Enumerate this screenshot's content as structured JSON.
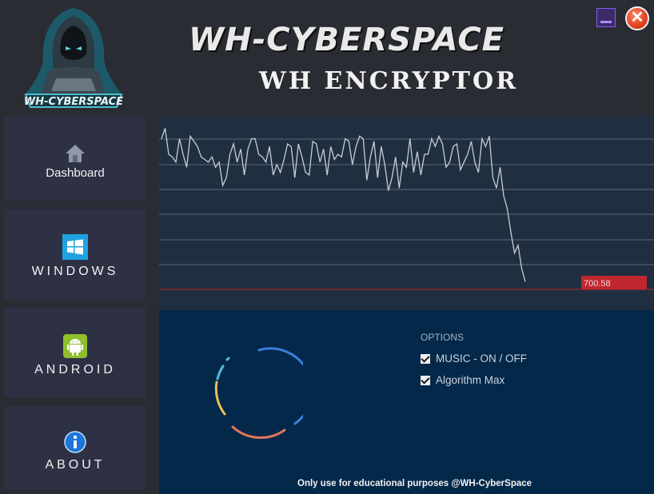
{
  "header": {
    "brand_title": "WH-CYBERSPACE",
    "app_title": "WH ENCRYPTOR",
    "logo_text": "WH-CYBERSPACE"
  },
  "window_controls": {
    "minimize_icon": "minimize-icon",
    "close_icon": "close-icon"
  },
  "sidebar": {
    "items": [
      {
        "label": "Dashboard",
        "icon": "home-icon"
      },
      {
        "label": "WINDOWS",
        "icon": "windows-logo-icon"
      },
      {
        "label": "ANDROID",
        "icon": "android-icon"
      },
      {
        "label": "ABOUT",
        "icon": "info-icon"
      }
    ]
  },
  "graph": {
    "current_value_label": "700.58",
    "line_color": "#c8ccd2",
    "threshold_color": "#c0262e",
    "values": [
      58,
      62,
      52,
      51,
      49,
      58,
      52,
      47,
      59,
      57,
      55,
      51,
      50,
      49,
      51,
      47,
      49,
      40,
      43,
      52,
      56,
      49,
      54,
      44,
      54,
      58,
      58,
      52,
      51,
      49,
      55,
      44,
      48,
      45,
      50,
      56,
      55,
      43,
      56,
      51,
      45,
      44,
      57,
      56,
      49,
      54,
      44,
      55,
      50,
      52,
      51,
      58,
      57,
      48,
      55,
      59,
      58,
      42,
      51,
      57,
      43,
      55,
      48,
      38,
      43,
      51,
      39,
      49,
      47,
      58,
      45,
      53,
      44,
      52,
      52,
      58,
      55,
      59,
      56,
      47,
      49,
      55,
      56,
      46,
      49,
      52,
      57,
      49,
      45,
      58,
      55,
      59,
      43,
      39,
      47,
      36,
      31,
      22,
      14,
      17,
      8,
      3
    ]
  },
  "options": {
    "title": "OPTIONS",
    "music_label": "MUSIC - ON / OFF",
    "algorithm_label": "Algorithm Max"
  },
  "footer_note": "Only use for educational purposes  @WH-CyberSpace"
}
